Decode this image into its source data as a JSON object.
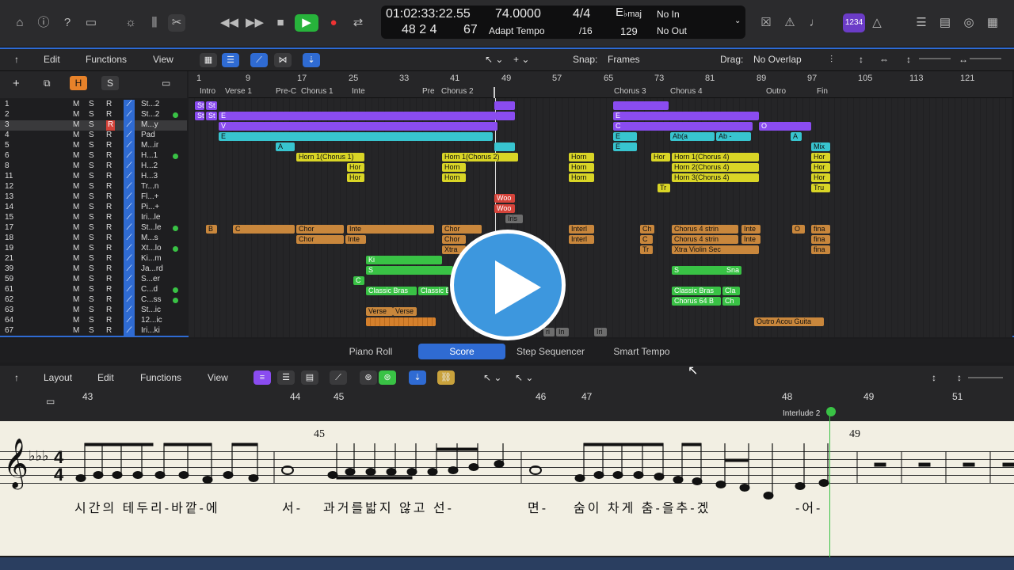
{
  "lcd": {
    "position": "01:02:33:22.55",
    "tempo": "74.0000",
    "signature": "4/4",
    "key_main": "E",
    "key_sub": "♭maj",
    "in": "No In",
    "bars": "48  2  4",
    "ticks": "67",
    "adapt": "Adapt Tempo",
    "division": "/16",
    "count": "129",
    "out": "No Out"
  },
  "top_badge": "1234",
  "menu": {
    "edit": "Edit",
    "functions": "Functions",
    "view": "View",
    "snap_label": "Snap:",
    "snap_value": "Frames",
    "drag_label": "Drag:",
    "drag_value": "No Overlap"
  },
  "header": {
    "h": "H",
    "s": "S"
  },
  "bars": [
    "1",
    "9",
    "17",
    "25",
    "33",
    "41",
    "49",
    "57",
    "65",
    "73",
    "81",
    "89",
    "97",
    "105",
    "113",
    "121"
  ],
  "markers": [
    "Intro",
    "Verse 1",
    "Pre-C",
    "Chorus 1",
    "Inte",
    "Pre",
    "Chorus 2",
    "Chorus 3",
    "Chorus 4",
    "Outro",
    "Fin"
  ],
  "tracks": [
    {
      "num": "1",
      "name": "St...2",
      "dot": false
    },
    {
      "num": "2",
      "name": "St...2",
      "dot": true
    },
    {
      "num": "3",
      "name": "M...y",
      "dot": false
    },
    {
      "num": "4",
      "name": "Pad",
      "dot": false
    },
    {
      "num": "5",
      "name": "M...ir",
      "dot": false
    },
    {
      "num": "6",
      "name": "H...1",
      "dot": true
    },
    {
      "num": "8",
      "name": "H...2",
      "dot": false
    },
    {
      "num": "11",
      "name": "H...3",
      "dot": false
    },
    {
      "num": "12",
      "name": "Tr...n",
      "dot": false
    },
    {
      "num": "13",
      "name": "Fl...+",
      "dot": false
    },
    {
      "num": "14",
      "name": "Pi...+",
      "dot": false
    },
    {
      "num": "15",
      "name": "Iri...le",
      "dot": false
    },
    {
      "num": "17",
      "name": "St...le",
      "dot": true
    },
    {
      "num": "18",
      "name": "M...s",
      "dot": false
    },
    {
      "num": "19",
      "name": "Xt...lo",
      "dot": true
    },
    {
      "num": "21",
      "name": "Ki...m",
      "dot": false
    },
    {
      "num": "39",
      "name": "Ja...rd",
      "dot": false
    },
    {
      "num": "59",
      "name": "S...er",
      "dot": false
    },
    {
      "num": "61",
      "name": "C...d",
      "dot": true
    },
    {
      "num": "62",
      "name": "C...ss",
      "dot": true
    },
    {
      "num": "63",
      "name": "St...ic",
      "dot": false
    },
    {
      "num": "64",
      "name": "12...ic",
      "dot": false
    },
    {
      "num": "67",
      "name": "Iri...ki",
      "dot": false
    }
  ],
  "regions": {
    "horn1": "Horn 1(Chorus 1)",
    "horn1b": "Horn 1(Chorus 2)",
    "horn": "Horn",
    "hor": "Hor",
    "horn1c": "Horn 1(Chorus 4)",
    "horn2c": "Horn 2(Chorus 4)",
    "horn3c": "Horn 3(Chorus 4)",
    "woo": "Woo",
    "iris": "Iris",
    "chor": "Chor",
    "inte": "Inte",
    "interl": "Interl",
    "ch": "Ch",
    "chorus4": "Chorus 4 strin",
    "xtra": "Xtra",
    "xtraviolin": "Xtra Violin Sec",
    "fina": "fina",
    "classic": "Classic Bras",
    "classicb": "Classic Bras",
    "cla": "Cla",
    "chorus64": "Chorus 64 B",
    "chs": "Ch",
    "verse": "Verse",
    "outro": "Outro Acou Guita",
    "mix": "Mix",
    "tru": "Tru",
    "tr": "Tr",
    "abg": "Ab(a",
    "ebg": "Eb/G",
    "cm": "Cm",
    "abm": "Ab -",
    "ki": "Ki",
    "sna": "Sna",
    "o": "O",
    "b": "B",
    "c": "C",
    "e": "E",
    "a": "A",
    "v": "V",
    "pr": "Pr",
    "st": "St",
    "s": "S",
    "iri": "Iri",
    "in": "In",
    "ri": "ri"
  },
  "tabs": {
    "piano": "Piano Roll",
    "score": "Score",
    "step": "Step Sequencer",
    "smart": "Smart Tempo"
  },
  "score_menu": {
    "layout": "Layout",
    "edit": "Edit",
    "functions": "Functions",
    "view": "View"
  },
  "score_bars": [
    "43",
    "44",
    "45",
    "46",
    "47",
    "48",
    "49",
    "51"
  ],
  "score_marker": "Interlude 2",
  "sheet": {
    "bar45": "45",
    "bar49": "49",
    "time_top": "4",
    "time_bottom": "4"
  },
  "lyrics": [
    "시간의 테두리-바깥-에",
    "서-",
    "과거를밟지 않고 선-",
    "면-",
    "숨이 차게 춤-을추-겠",
    "-어-"
  ]
}
